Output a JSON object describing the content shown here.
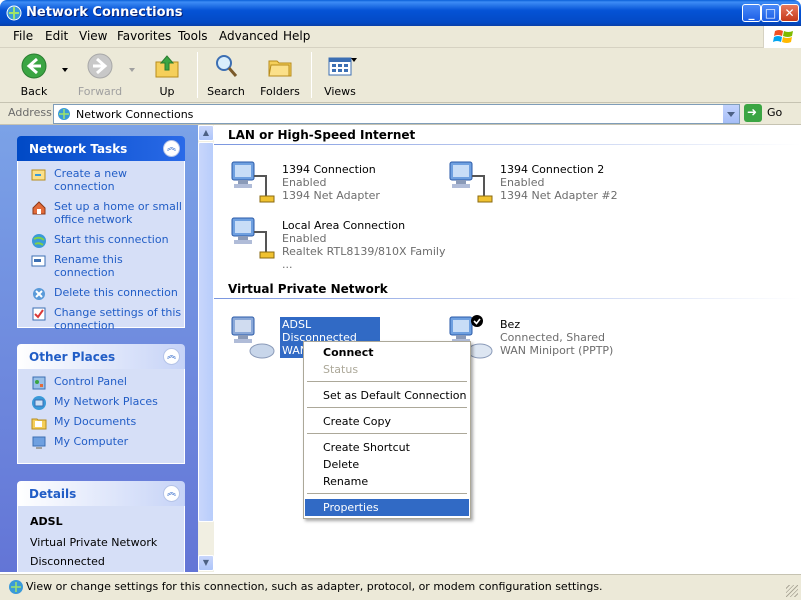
{
  "window": {
    "title": "Network Connections",
    "minimize_label": "_",
    "maximize_label": "□",
    "close_label": "✕"
  },
  "menubar": {
    "items": [
      "File",
      "Edit",
      "View",
      "Favorites",
      "Tools",
      "Advanced",
      "Help"
    ]
  },
  "toolbar": {
    "back": "Back",
    "forward": "Forward",
    "up": "Up",
    "search": "Search",
    "folders": "Folders",
    "views": "Views"
  },
  "address": {
    "label": "Address",
    "value": "Network Connections",
    "go": "Go"
  },
  "network_tasks": {
    "title": "Network Tasks",
    "items": [
      "Create a new connection",
      "Set up a home or small office network",
      "Start this connection",
      "Rename this connection",
      "Delete this connection",
      "Change settings of this connection"
    ]
  },
  "other_places": {
    "title": "Other Places",
    "items": [
      "Control Panel",
      "My Network Places",
      "My Documents",
      "My Computer"
    ]
  },
  "details": {
    "title": "Details",
    "name": "ADSL",
    "type": "Virtual Private Network",
    "status": "Disconnected"
  },
  "groups": {
    "lan": {
      "title": "LAN or High-Speed Internet",
      "items": [
        {
          "name": "1394 Connection",
          "status": "Enabled",
          "device": "1394 Net Adapter"
        },
        {
          "name": "1394 Connection 2",
          "status": "Enabled",
          "device": "1394 Net Adapter #2"
        },
        {
          "name": "Local Area Connection",
          "status": "Enabled",
          "device": "Realtek RTL8139/810X Family ..."
        }
      ]
    },
    "vpn": {
      "title": "Virtual Private Network",
      "items": [
        {
          "name": "ADSL",
          "status": "Disconnected",
          "device": "WAN"
        },
        {
          "name": "Bez",
          "status": "Connected, Shared",
          "device": "WAN Miniport (PPTP)"
        }
      ]
    }
  },
  "context_menu": {
    "items": [
      "Connect",
      "Status",
      "Set as Default Connection",
      "Create Copy",
      "Create Shortcut",
      "Delete",
      "Rename",
      "Properties"
    ]
  },
  "status_bar": {
    "text": "View or change settings for this connection, such as adapter, protocol, or modem configuration settings."
  },
  "colors": {
    "selection": "#316ac5",
    "task_pane": "#7ba2e7",
    "link": "#215dc6"
  }
}
